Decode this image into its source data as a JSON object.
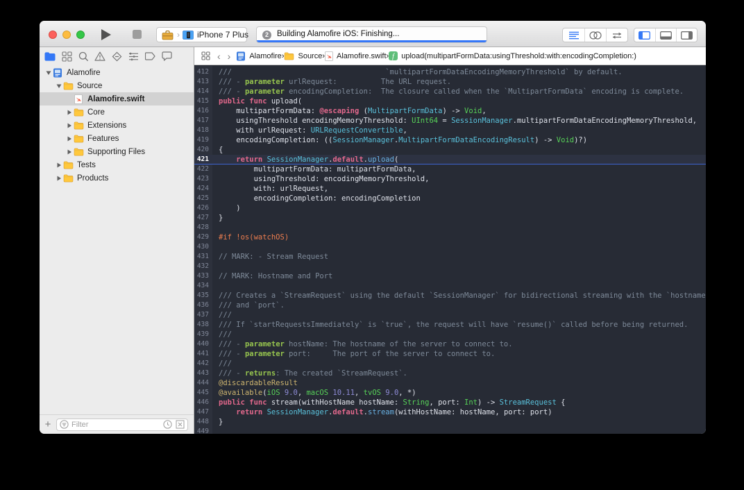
{
  "colors": {
    "accent_blue": "#3478F6",
    "editor_bg": "#272B35",
    "gutter_bg": "#2D313C",
    "current_line_bg": "#2D3242",
    "current_line_rule": "#3E63D0",
    "progress_bar": "#3577F7",
    "plain": "#DFE2EA",
    "comment": "#7E8A99",
    "doc_keyword": "#96C44E",
    "keyword": "#E2688C",
    "type_project": "#5AC1DB",
    "function_call": "#69B2E4",
    "type_builtin": "#57D258",
    "number": "#8E8BD6",
    "attribute": "#CEB56F",
    "preprocessor": "#EE7E4F",
    "line_number": "#808798"
  },
  "toolbar": {
    "device": "iPhone 7 Plus",
    "activity_text": "Building Alamofire iOS: Finishing...",
    "activity_badge": "2",
    "editor_modes": [
      "standard-editor",
      "assistant-editor",
      "version-editor"
    ],
    "panel_toggles": [
      "navigator-panel",
      "debug-area",
      "inspector-panel"
    ]
  },
  "navigator": {
    "tabs": [
      "project",
      "symbols",
      "search",
      "issues",
      "tests",
      "debug",
      "breakpoints",
      "reports"
    ],
    "active_tab": 0,
    "filter_placeholder": "Filter",
    "tree": [
      {
        "label": "Alamofire",
        "icon": "project",
        "level": 0,
        "disc": "open",
        "selected": false
      },
      {
        "label": "Source",
        "icon": "folder",
        "level": 1,
        "disc": "open",
        "selected": false
      },
      {
        "label": "Alamofire.swift",
        "icon": "swift",
        "level": 2,
        "disc": "none",
        "selected": true
      },
      {
        "label": "Core",
        "icon": "folder",
        "level": 2,
        "disc": "closed",
        "selected": false
      },
      {
        "label": "Extensions",
        "icon": "folder",
        "level": 2,
        "disc": "closed",
        "selected": false
      },
      {
        "label": "Features",
        "icon": "folder",
        "level": 2,
        "disc": "closed",
        "selected": false
      },
      {
        "label": "Supporting Files",
        "icon": "folder",
        "level": 2,
        "disc": "closed",
        "selected": false
      },
      {
        "label": "Tests",
        "icon": "folder",
        "level": 1,
        "disc": "closed",
        "selected": false
      },
      {
        "label": "Products",
        "icon": "folder",
        "level": 1,
        "disc": "closed",
        "selected": false
      }
    ]
  },
  "jumpbar": {
    "crumbs": [
      {
        "icon": "project",
        "label": "Alamofire"
      },
      {
        "icon": "folder",
        "label": "Source"
      },
      {
        "icon": "swift",
        "label": "Alamofire.swift"
      },
      {
        "icon": "func",
        "label": "upload(multipartFormData:usingThreshold:with:encodingCompletion:)"
      }
    ]
  },
  "editor": {
    "current_line": 421,
    "lines": [
      {
        "n": 412,
        "t": [
          [
            "c",
            "///                                   `multipartFormDataEncodingMemoryThreshold` by default."
          ]
        ]
      },
      {
        "n": 413,
        "t": [
          [
            "c",
            "/// - "
          ],
          [
            "dk",
            "parameter"
          ],
          [
            "c",
            " urlRequest:          The URL request."
          ]
        ]
      },
      {
        "n": 414,
        "t": [
          [
            "c",
            "/// - "
          ],
          [
            "dk",
            "parameter"
          ],
          [
            "c",
            " encodingCompletion:  The closure called when the `MultipartFormData` encoding is complete."
          ]
        ]
      },
      {
        "n": 415,
        "t": [
          [
            "k",
            "public func "
          ],
          [
            "p",
            "upload("
          ]
        ]
      },
      {
        "n": 416,
        "t": [
          [
            "p",
            "    multipartFormData: "
          ],
          [
            "k",
            "@escaping"
          ],
          [
            "p",
            " ("
          ],
          [
            "t",
            "MultipartFormData"
          ],
          [
            "p",
            ") -> "
          ],
          [
            "bt",
            "Void"
          ],
          [
            "p",
            ","
          ]
        ]
      },
      {
        "n": 417,
        "t": [
          [
            "p",
            "    usingThreshold encodingMemoryThreshold: "
          ],
          [
            "bt",
            "UInt64"
          ],
          [
            "p",
            " = "
          ],
          [
            "t",
            "SessionManager"
          ],
          [
            "p",
            ".multipartFormDataEncodingMemoryThreshold,"
          ]
        ]
      },
      {
        "n": 418,
        "t": [
          [
            "p",
            "    with urlRequest: "
          ],
          [
            "t",
            "URLRequestConvertible"
          ],
          [
            "p",
            ","
          ]
        ]
      },
      {
        "n": 419,
        "t": [
          [
            "p",
            "    encodingCompletion: (("
          ],
          [
            "t",
            "SessionManager"
          ],
          [
            "p",
            "."
          ],
          [
            "t",
            "MultipartFormDataEncodingResult"
          ],
          [
            "p",
            ") -> "
          ],
          [
            "bt",
            "Void"
          ],
          [
            "p",
            ")?)"
          ]
        ]
      },
      {
        "n": 420,
        "t": [
          [
            "p",
            "{"
          ]
        ]
      },
      {
        "n": 421,
        "t": [
          [
            "p",
            "    "
          ],
          [
            "k",
            "return"
          ],
          [
            "p",
            " "
          ],
          [
            "t",
            "SessionManager"
          ],
          [
            "p",
            "."
          ],
          [
            "k",
            "default"
          ],
          [
            "p",
            "."
          ],
          [
            "fn",
            "upload"
          ],
          [
            "p",
            "("
          ]
        ]
      },
      {
        "n": 422,
        "t": [
          [
            "p",
            "        multipartFormData: multipartFormData,"
          ]
        ]
      },
      {
        "n": 423,
        "t": [
          [
            "p",
            "        usingThreshold: encodingMemoryThreshold,"
          ]
        ]
      },
      {
        "n": 424,
        "t": [
          [
            "p",
            "        with: urlRequest,"
          ]
        ]
      },
      {
        "n": 425,
        "t": [
          [
            "p",
            "        encodingCompletion: encodingCompletion"
          ]
        ]
      },
      {
        "n": 426,
        "t": [
          [
            "p",
            "    )"
          ]
        ]
      },
      {
        "n": 427,
        "t": [
          [
            "p",
            "}"
          ]
        ]
      },
      {
        "n": 428,
        "t": []
      },
      {
        "n": 429,
        "t": [
          [
            "pp",
            "#if !os(watchOS)"
          ]
        ]
      },
      {
        "n": 430,
        "t": []
      },
      {
        "n": 431,
        "t": [
          [
            "c",
            "// MARK: - Stream Request"
          ]
        ]
      },
      {
        "n": 432,
        "t": []
      },
      {
        "n": 433,
        "t": [
          [
            "c",
            "// MARK: Hostname and Port"
          ]
        ]
      },
      {
        "n": 434,
        "t": []
      },
      {
        "n": 435,
        "t": [
          [
            "c",
            "/// Creates a `StreamRequest` using the default `SessionManager` for bidirectional streaming with the `hostname`"
          ]
        ]
      },
      {
        "n": 436,
        "t": [
          [
            "c",
            "/// and `port`."
          ]
        ]
      },
      {
        "n": 437,
        "t": [
          [
            "c",
            "///"
          ]
        ]
      },
      {
        "n": 438,
        "t": [
          [
            "c",
            "/// If `startRequestsImmediately` is `true`, the request will have `resume()` called before being returned."
          ]
        ]
      },
      {
        "n": 439,
        "t": [
          [
            "c",
            "///"
          ]
        ]
      },
      {
        "n": 440,
        "t": [
          [
            "c",
            "/// - "
          ],
          [
            "dk",
            "parameter"
          ],
          [
            "c",
            " hostName: The hostname of the server to connect to."
          ]
        ]
      },
      {
        "n": 441,
        "t": [
          [
            "c",
            "/// - "
          ],
          [
            "dk",
            "parameter"
          ],
          [
            "c",
            " port:     The port of the server to connect to."
          ]
        ]
      },
      {
        "n": 442,
        "t": [
          [
            "c",
            "///"
          ]
        ]
      },
      {
        "n": 443,
        "t": [
          [
            "c",
            "/// - "
          ],
          [
            "dk",
            "returns"
          ],
          [
            "c",
            ": The created `StreamRequest`."
          ]
        ]
      },
      {
        "n": 444,
        "t": [
          [
            "at",
            "@discardableResult"
          ]
        ]
      },
      {
        "n": 445,
        "t": [
          [
            "at",
            "@available"
          ],
          [
            "p",
            "("
          ],
          [
            "bt",
            "iOS"
          ],
          [
            "p",
            " "
          ],
          [
            "n",
            "9.0"
          ],
          [
            "p",
            ", "
          ],
          [
            "bt",
            "macOS"
          ],
          [
            "p",
            " "
          ],
          [
            "n",
            "10.11"
          ],
          [
            "p",
            ", "
          ],
          [
            "bt",
            "tvOS"
          ],
          [
            "p",
            " "
          ],
          [
            "n",
            "9.0"
          ],
          [
            "p",
            ", *)"
          ]
        ]
      },
      {
        "n": 446,
        "t": [
          [
            "k",
            "public func "
          ],
          [
            "p",
            "stream(withHostName hostName: "
          ],
          [
            "bt",
            "String"
          ],
          [
            "p",
            ", port: "
          ],
          [
            "bt",
            "Int"
          ],
          [
            "p",
            ") -> "
          ],
          [
            "t",
            "StreamRequest"
          ],
          [
            "p",
            " {"
          ]
        ]
      },
      {
        "n": 447,
        "t": [
          [
            "p",
            "    "
          ],
          [
            "k",
            "return"
          ],
          [
            "p",
            " "
          ],
          [
            "t",
            "SessionManager"
          ],
          [
            "p",
            "."
          ],
          [
            "k",
            "default"
          ],
          [
            "p",
            "."
          ],
          [
            "fn",
            "stream"
          ],
          [
            "p",
            "(withHostName: hostName, port: port)"
          ]
        ]
      },
      {
        "n": 448,
        "t": [
          [
            "p",
            "}"
          ]
        ]
      },
      {
        "n": 449,
        "t": []
      }
    ]
  }
}
